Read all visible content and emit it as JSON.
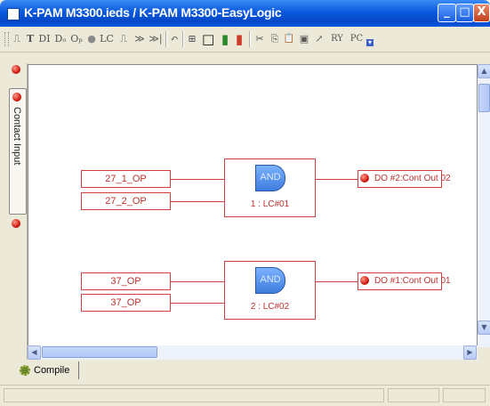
{
  "window": {
    "title": "K-PAM M3300.ieds / K-PAM M3300-EasyLogic",
    "buttons": {
      "minimize": "_",
      "maximize": "□",
      "close": "X"
    }
  },
  "toolbar": {
    "tools": [
      {
        "name": "timer-tool",
        "label": "⎍"
      },
      {
        "name": "text-tool",
        "label": "T"
      },
      {
        "name": "di-tool",
        "label": "DI"
      },
      {
        "name": "do-tool",
        "label": "Dₒ"
      },
      {
        "name": "op-tool",
        "label": "Oₚ"
      },
      {
        "name": "led-tool",
        "label": "●"
      },
      {
        "name": "lc-tool",
        "label": "LC"
      },
      {
        "name": "pulse-tool",
        "label": "⎍"
      },
      {
        "name": "forward-tool",
        "label": "≫"
      },
      {
        "name": "forward2-tool",
        "label": "≫|"
      },
      {
        "name": "undo-tool",
        "label": "↶"
      },
      {
        "name": "grid-tool",
        "label": "⊞"
      },
      {
        "name": "frame-tool",
        "label": "□"
      },
      {
        "name": "color-tool",
        "label": "▮"
      },
      {
        "name": "color2-tool",
        "label": "▮"
      },
      {
        "name": "cut-tool",
        "label": "✂"
      },
      {
        "name": "copy-tool",
        "label": "⎘"
      },
      {
        "name": "paste-tool",
        "label": "📋"
      },
      {
        "name": "save-tool",
        "label": "▣"
      },
      {
        "name": "open-tool",
        "label": "↗"
      },
      {
        "name": "to-ry-tool",
        "label": "RY"
      },
      {
        "name": "to-pc-tool",
        "label": "PC"
      }
    ]
  },
  "side_panel": {
    "tab_label": "Contact Input"
  },
  "diagram": {
    "blocks": [
      {
        "inputs": [
          "27_1_OP",
          "27_2_OP"
        ],
        "gate": "AND",
        "gate_label": "1 : LC#01",
        "output": "DO #2:Cont Out 02"
      },
      {
        "inputs": [
          "37_OP",
          "37_OP"
        ],
        "gate": "AND",
        "gate_label": "2 : LC#02",
        "output": "DO #1:Cont Out 01"
      }
    ]
  },
  "bottom_tabs": [
    {
      "label": "Compile"
    }
  ]
}
